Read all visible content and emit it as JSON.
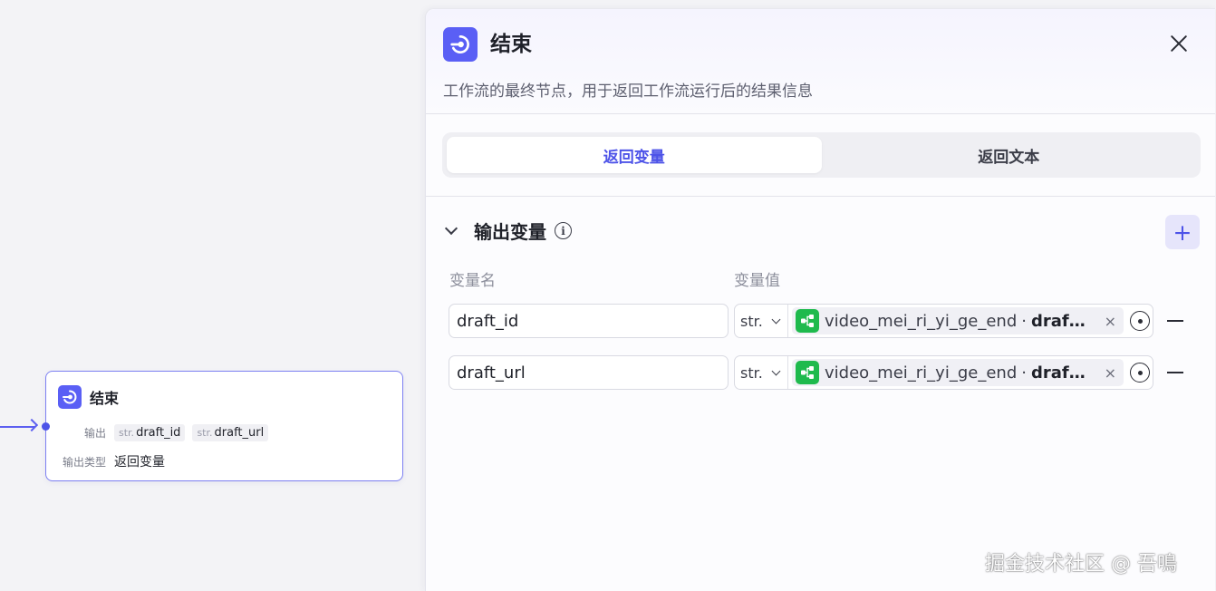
{
  "canvas": {
    "node": {
      "title": "结束",
      "output_label": "输出",
      "outputs": [
        {
          "type": "str.",
          "name": "draft_id"
        },
        {
          "type": "str.",
          "name": "draft_url"
        }
      ],
      "output_type_label": "输出类型",
      "output_type_value": "返回变量"
    }
  },
  "panel": {
    "title": "结束",
    "description": "工作流的最终节点，用于返回工作流运行后的结果信息",
    "tabs": [
      {
        "label": "返回变量",
        "active": true
      },
      {
        "label": "返回文本",
        "active": false
      }
    ],
    "section": {
      "title": "输出变量",
      "col_name": "变量名",
      "col_value": "变量值",
      "rows": [
        {
          "name": "draft_id",
          "type": "str.",
          "ref_node": "video_mei_ri_yi_ge_end",
          "ref_sep": "·",
          "ref_var": "draft_id"
        },
        {
          "name": "draft_url",
          "type": "str.",
          "ref_node": "video_mei_ri_yi_ge_end",
          "ref_sep": "·",
          "ref_var": "draft_url"
        }
      ]
    }
  },
  "watermark": "掘金技术社区 @ 吾鳴",
  "colors": {
    "accent": "#4d53e8",
    "node_icon_bg": "#5a5ff5",
    "ref_icon_bg": "#1fba4d"
  }
}
